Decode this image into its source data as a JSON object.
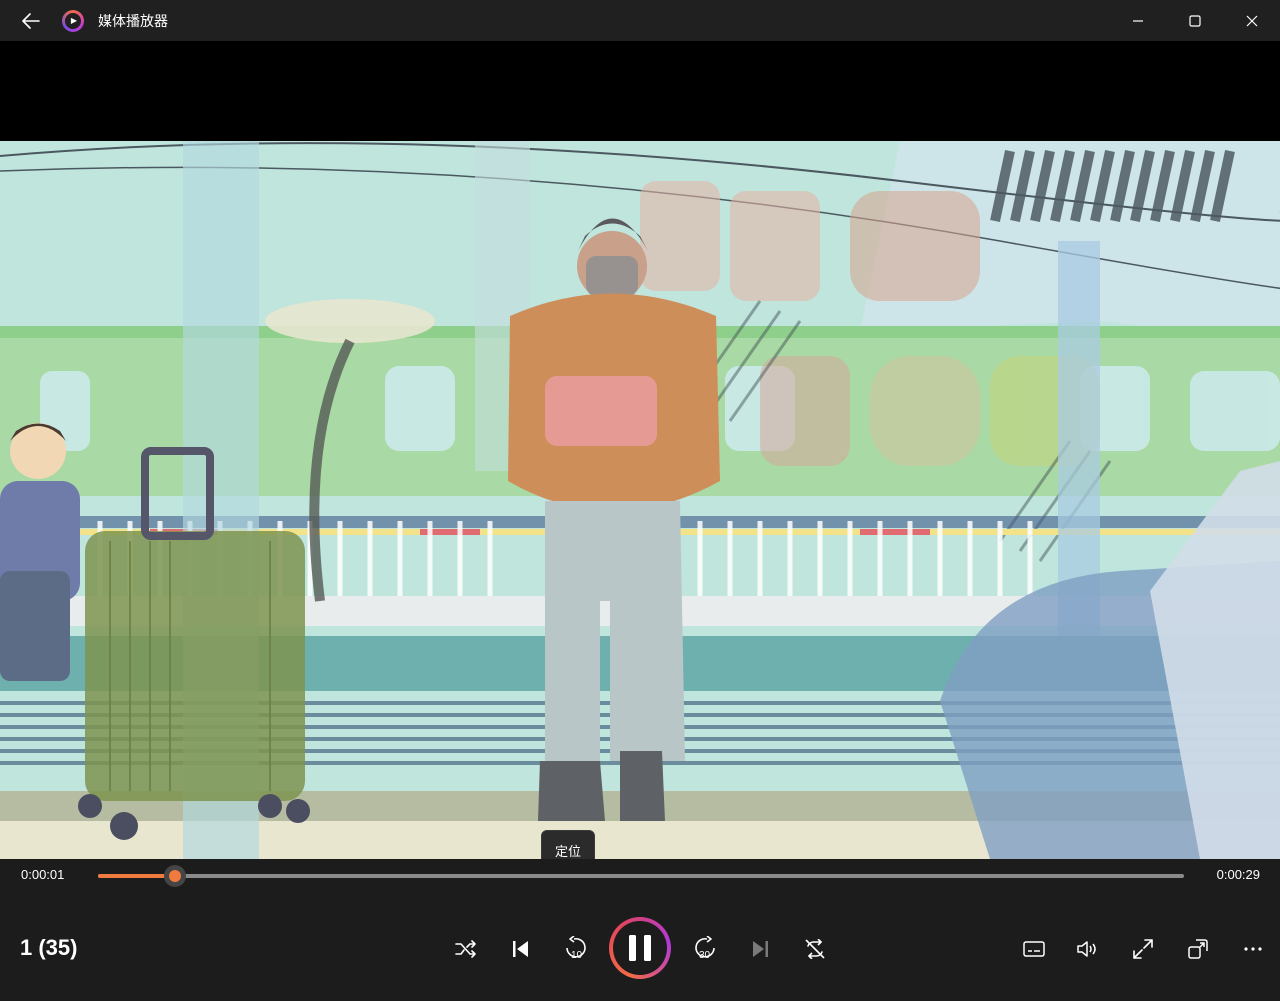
{
  "window": {
    "title": "媒体播放器",
    "back_icon": "back-arrow-icon",
    "controls": [
      "minimize-icon",
      "maximize-icon",
      "close-icon"
    ]
  },
  "tooltip": {
    "text": "定位"
  },
  "player": {
    "current_time": "0:00:01",
    "total_time": "0:00:29",
    "progress": 0.071,
    "playlist_position": "1 (35)",
    "state": "playing",
    "accent_color": "#f07b3f"
  },
  "buttons": {
    "center": [
      "shuffle-icon",
      "previous-icon",
      "skip-back-10-icon",
      "pause-icon",
      "skip-forward-30-icon",
      "next-icon",
      "repeat-off-icon"
    ],
    "right": [
      "subtitles-icon",
      "volume-icon",
      "fullscreen-icon",
      "mini-view-icon",
      "more-icon"
    ],
    "skip_back_label": "10",
    "skip_forward_label": "30"
  }
}
